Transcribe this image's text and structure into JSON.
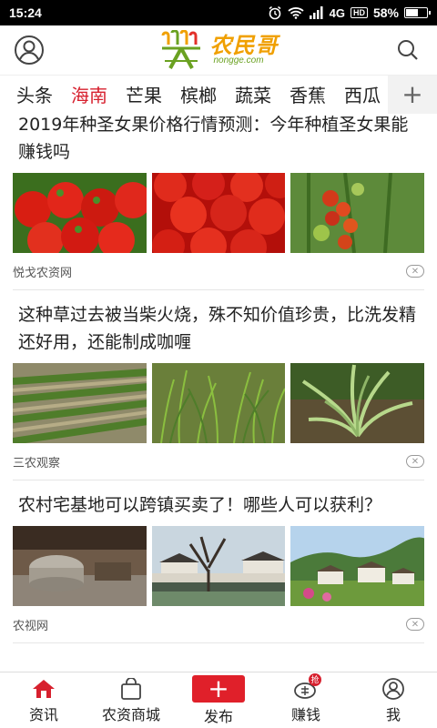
{
  "status_bar": {
    "time": "15:24",
    "network": "4G",
    "hd": "HD",
    "battery": "58%",
    "battery_level": 0.58
  },
  "header": {
    "logo_cn": "农民哥",
    "logo_en": "nongge.com"
  },
  "tabs": {
    "items": [
      "头条",
      "海南",
      "芒果",
      "槟榔",
      "蔬菜",
      "香蕉",
      "西瓜"
    ],
    "active": "海南",
    "add_label": "+"
  },
  "articles": [
    {
      "title": "2019年种圣女果价格行情预测：今年种植圣女果能赚钱吗",
      "source": "悦戈农资网",
      "images": [
        "cherry-tomatoes",
        "red-tomatoes",
        "tomato-plant"
      ]
    },
    {
      "title": "这种草过去被当柴火烧，殊不知价值珍贵，比洗发精还好用，还能制成咖喱",
      "source": "三农观察",
      "images": [
        "grass-rows",
        "grass-field",
        "lemongrass-plant"
      ]
    },
    {
      "title": "农村宅基地可以跨镇买卖了！哪些人可以获利？",
      "source": "农视网",
      "images": [
        "stone-mill",
        "village-tree",
        "village-houses"
      ]
    }
  ],
  "bottom_nav": {
    "news": "资讯",
    "mall": "农资商城",
    "publish": "发布",
    "earn": "赚钱",
    "earn_badge": "抢",
    "me": "我"
  },
  "colors": {
    "accent": "#d7202e",
    "logo_orange": "#f0a000",
    "logo_green": "#6aa121"
  }
}
